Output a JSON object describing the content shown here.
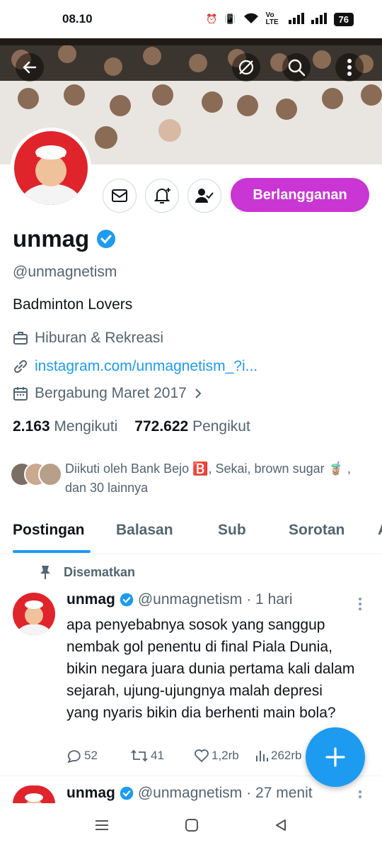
{
  "status_bar": {
    "time": "08.10",
    "battery": "76",
    "network": "Vo LTE"
  },
  "profile": {
    "name": "unmag",
    "handle": "@unmagnetism",
    "bio": "Badminton Lovers",
    "category": "Hiburan & Rekreasi",
    "link": "instagram.com/unmagnetism_?i...",
    "joined": "Bergabung Maret 2017",
    "following_count": "2.163",
    "following_label": "Mengikuti",
    "followers_count": "772.622",
    "followers_label": "Pengikut",
    "followed_by": "Diikuti oleh Bank Bejo 🅱️, Sekai, brown sugar 🧋 , dan 30 lainnya",
    "subscribe_label": "Berlangganan"
  },
  "tabs": [
    {
      "label": "Postingan"
    },
    {
      "label": "Balasan"
    },
    {
      "label": "Sub"
    },
    {
      "label": "Sorotan"
    },
    {
      "label": "A"
    }
  ],
  "pinned_label": "Disematkan",
  "tweets": [
    {
      "name": "unmag",
      "handle": "@unmagnetism",
      "time": "· 1 hari",
      "text": "apa penyebabnya sosok yang sanggup nembak gol penentu di final Piala Dunia, bikin negara juara dunia pertama kali dalam sejarah, ujung-ujungnya malah depresi yang nyaris bikin dia berhenti main bola?",
      "replies": "52",
      "retweets": "41",
      "likes": "1,2rb",
      "views": "262rb"
    },
    {
      "name": "unmag",
      "handle": "@unmagnetism",
      "time": "· 27 menit"
    }
  ],
  "colors": {
    "accent": "#1d9bf0",
    "subscribe": "#c936d3",
    "verified": "#1d9bf0"
  }
}
